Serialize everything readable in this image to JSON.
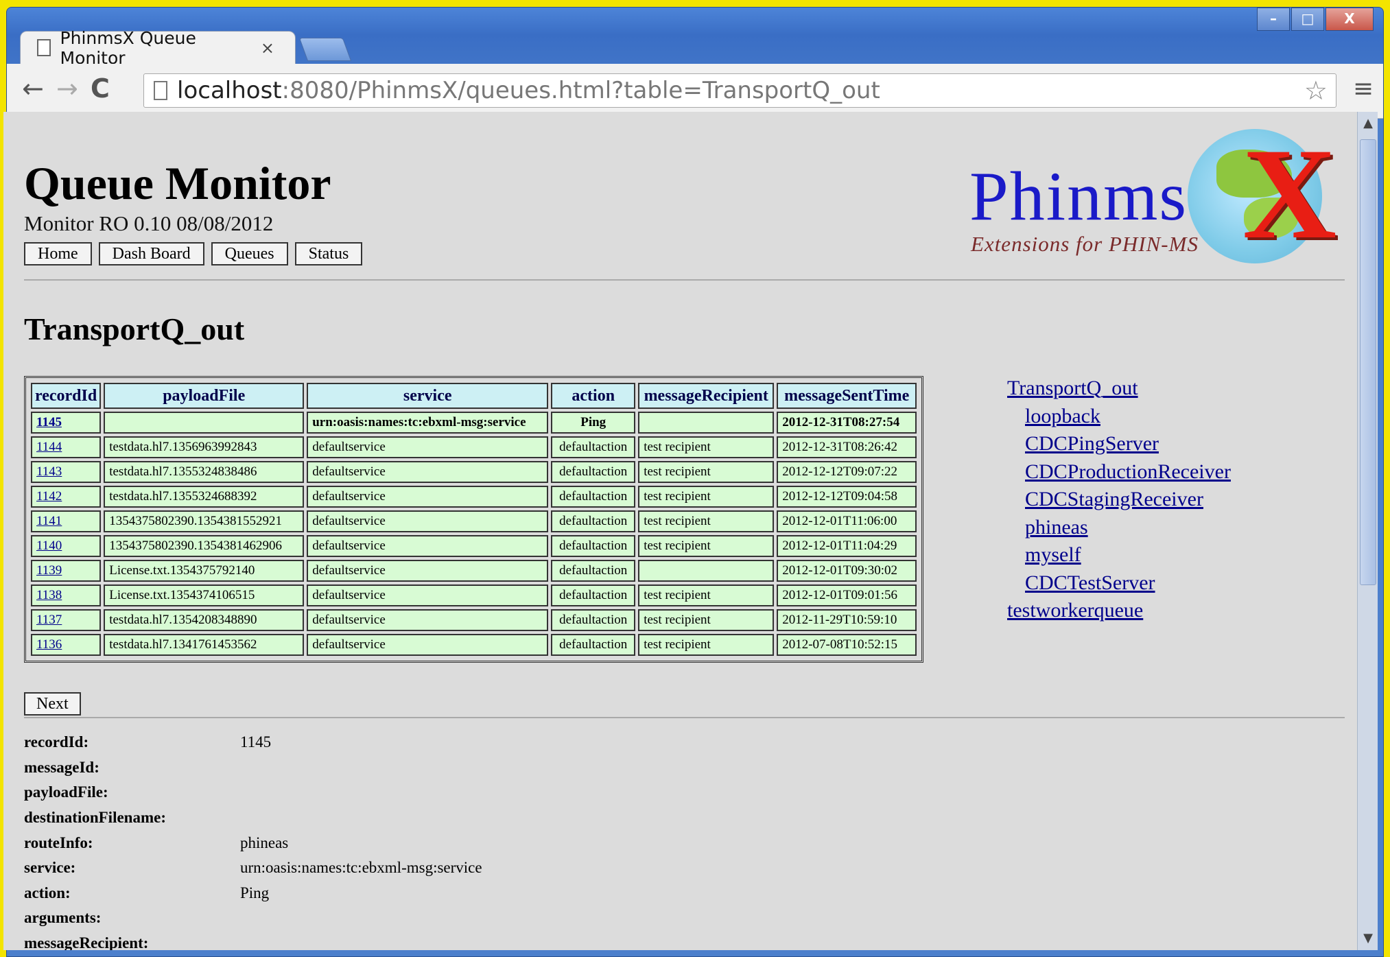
{
  "browser": {
    "tab_title": "PhinmsX Queue Monitor",
    "tab_close": "×",
    "url_host": "localhost",
    "url_rest": ":8080/PhinmsX/queues.html?table=TransportQ_out",
    "back": "←",
    "forward": "→",
    "reload": "C",
    "star": "☆",
    "menu": "≡",
    "win_min": "–",
    "win_max": "□",
    "win_close": "X"
  },
  "header": {
    "title": "Queue Monitor",
    "subtitle": "Monitor RO 0.10 08/08/2012",
    "nav": [
      "Home",
      "Dash Board",
      "Queues",
      "Status"
    ]
  },
  "logo": {
    "word": "Phinms",
    "x": "X",
    "tagline": "Extensions for PHIN-MS"
  },
  "queue": {
    "name": "TransportQ_out",
    "columns": [
      "recordId",
      "payloadFile",
      "service",
      "action",
      "messageRecipient",
      "messageSentTime"
    ],
    "rows": [
      [
        "1145",
        "",
        "urn:oasis:names:tc:ebxml-msg:service",
        "Ping",
        "",
        "2012-12-31T08:27:54"
      ],
      [
        "1144",
        "testdata.hl7.1356963992843",
        "defaultservice",
        "defaultaction",
        "test recipient",
        "2012-12-31T08:26:42"
      ],
      [
        "1143",
        "testdata.hl7.1355324838486",
        "defaultservice",
        "defaultaction",
        "test recipient",
        "2012-12-12T09:07:22"
      ],
      [
        "1142",
        "testdata.hl7.1355324688392",
        "defaultservice",
        "defaultaction",
        "test recipient",
        "2012-12-12T09:04:58"
      ],
      [
        "1141",
        "1354375802390.1354381552921",
        "defaultservice",
        "defaultaction",
        "test recipient",
        "2012-12-01T11:06:00"
      ],
      [
        "1140",
        "1354375802390.1354381462906",
        "defaultservice",
        "defaultaction",
        "test recipient",
        "2012-12-01T11:04:29"
      ],
      [
        "1139",
        "License.txt.1354375792140",
        "defaultservice",
        "defaultaction",
        "",
        "2012-12-01T09:30:02"
      ],
      [
        "1138",
        "License.txt.1354374106515",
        "defaultservice",
        "defaultaction",
        "test recipient",
        "2012-12-01T09:01:56"
      ],
      [
        "1137",
        "testdata.hl7.1354208348890",
        "defaultservice",
        "defaultaction",
        "test recipient",
        "2012-11-29T10:59:10"
      ],
      [
        "1136",
        "testdata.hl7.1341761453562",
        "defaultservice",
        "defaultaction",
        "test recipient",
        "2012-07-08T10:52:15"
      ]
    ],
    "next_label": "Next"
  },
  "side_links": [
    {
      "label": "TransportQ_out",
      "indent": false
    },
    {
      "label": "loopback",
      "indent": true
    },
    {
      "label": "CDCPingServer",
      "indent": true
    },
    {
      "label": "CDCProductionReceiver",
      "indent": true
    },
    {
      "label": "CDCStagingReceiver",
      "indent": true
    },
    {
      "label": "phineas",
      "indent": true
    },
    {
      "label": "myself",
      "indent": true
    },
    {
      "label": "CDCTestServer",
      "indent": true
    },
    {
      "label": "testworkerqueue",
      "indent": false
    }
  ],
  "details": [
    {
      "key": "recordId:",
      "value": "1145"
    },
    {
      "key": "messageId:",
      "value": ""
    },
    {
      "key": "payloadFile:",
      "value": ""
    },
    {
      "key": "destinationFilename:",
      "value": ""
    },
    {
      "key": "routeInfo:",
      "value": "phineas"
    },
    {
      "key": "service:",
      "value": "urn:oasis:names:tc:ebxml-msg:service"
    },
    {
      "key": "action:",
      "value": "Ping"
    },
    {
      "key": "arguments:",
      "value": ""
    },
    {
      "key": "messageRecipient:",
      "value": ""
    }
  ]
}
